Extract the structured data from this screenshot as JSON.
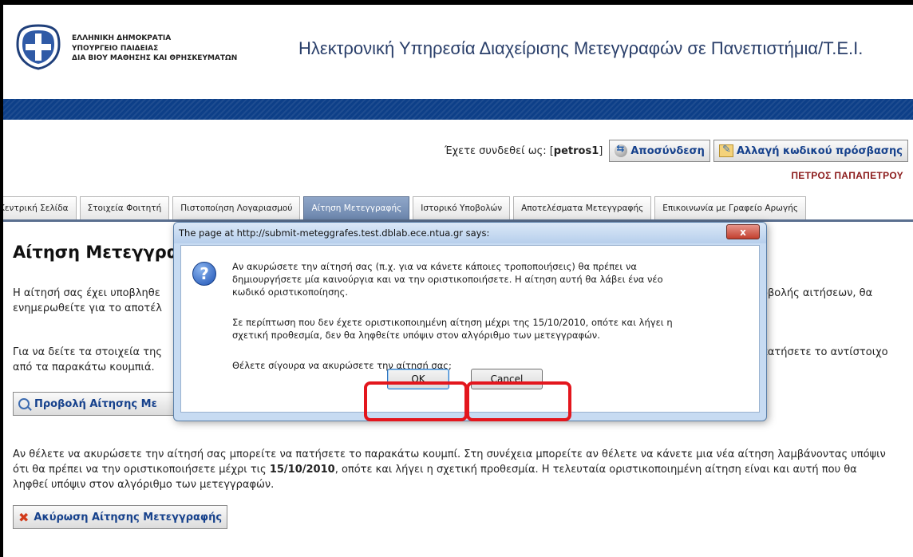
{
  "header": {
    "ministry_lines": [
      "ΕΛΛΗΝΙΚΗ ΔΗΜΟΚΡΑΤΙΑ",
      "ΥΠΟΥΡΓΕΙΟ ΠΑΙΔΕΙΑΣ",
      "ΔΙΑ ΒΙΟΥ ΜΑΘΗΣΗΣ ΚΑΙ ΘΡΗΣΚΕΥΜΑΤΩΝ"
    ],
    "site_title": "Ηλεκτρονική Υπηρεσία Διαχείρισης Μετεγγραφών σε Πανεπιστήμια/Τ.Ε.Ι.",
    "bar_color": "#0d3f88"
  },
  "user": {
    "logged_in_prefix": "Έχετε συνδεθεί ως: [",
    "username": "petros1",
    "logged_in_suffix": "]",
    "logout_label": "Αποσύνδεση",
    "change_password_label": "Αλλαγή κωδικού πρόσβασης",
    "full_name": "ΠΕΤΡΟΣ ΠΑΠΑΠΕΤΡΟΥ"
  },
  "tabs": [
    {
      "label": "Κεντρική Σελίδα",
      "active": false
    },
    {
      "label": "Στοιχεία Φοιτητή",
      "active": false
    },
    {
      "label": "Πιστοποίηση Λογαριασμού",
      "active": false
    },
    {
      "label": "Αίτηση Μετεγγραφής",
      "active": true
    },
    {
      "label": "Ιστορικό Υποβολών",
      "active": false
    },
    {
      "label": "Αποτελέσματα Μετεγγραφής",
      "active": false
    },
    {
      "label": "Επικοινωνία με Γραφείο Αρωγής",
      "active": false
    }
  ],
  "main": {
    "heading": "Αίτηση Μετεγγρα",
    "p1_line1_left": "Η αίτησή σας έχει υποβληθε",
    "p1_line1_right": "οβολής αιτήσεων, θα",
    "p1_line2_left": "ενημερωθείτε για το αποτέλ",
    "p2_line1_left": "Για να δείτε τα στοιχεία της",
    "p2_line1_right": "πατήσετε το αντίστοιχο",
    "p2_line2_left": "από τα παρακάτω κουμπιά.",
    "view_button_label": "Προβολή Αίτησης Με",
    "p3_line1": "Αν θέλετε να ακυρώσετε την αίτησή σας μπορείτε να πατήσετε το παρακάτω κουμπί. Στη συνέχεια μπορείτε αν θέλετε να κάνετε μια νέα αίτηση λαμβάνοντας υπόψιν",
    "p3_line2_a": "ότι θα πρέπει να την οριστικοποιήσετε μέχρι τις ",
    "p3_line2_date": "15/10/2010",
    "p3_line2_b": ", οπότε και λήγει η σχετική προθεσμία. Η τελευταία οριστικοποιημένη αίτηση είναι και αυτή που θα",
    "p3_line3": "ληφθεί υπόψιν στον αλγόριθμο των μετεγγραφών.",
    "cancel_application_label": "Ακύρωση Αίτησης Μετεγγραφής"
  },
  "dialog": {
    "title": "The page at http://submit-meteggrafes.test.dblab.ece.ntua.gr says:",
    "close_label": "x",
    "icon_glyph": "?",
    "lines": [
      "Αν ακυρώσετε την αίτησή σας (π.χ. για να κάνετε κάποιες τροποποιήσεις) θα πρέπει να",
      "δημιουργήσετε μία καινούργια και να την οριστικοποιήσετε. Η αίτηση αυτή θα λάβει ένα νέο",
      "κωδικό οριστικοποίησης.",
      "Σε περίπτωση που δεν έχετε οριστικοποιημένη αίτηση μέχρι της 15/10/2010, οπότε και λήγει η",
      "σχετική προθεσμία, δεν θα ληφθείτε υπόψιν στον αλγόριθμο των μετεγγραφών.",
      "Θέλετε σίγουρα να ακυρώσετε την αίτησή σας;"
    ],
    "ok_label": "OK",
    "cancel_label": "Cancel",
    "highlight_color": "#e3161d"
  }
}
